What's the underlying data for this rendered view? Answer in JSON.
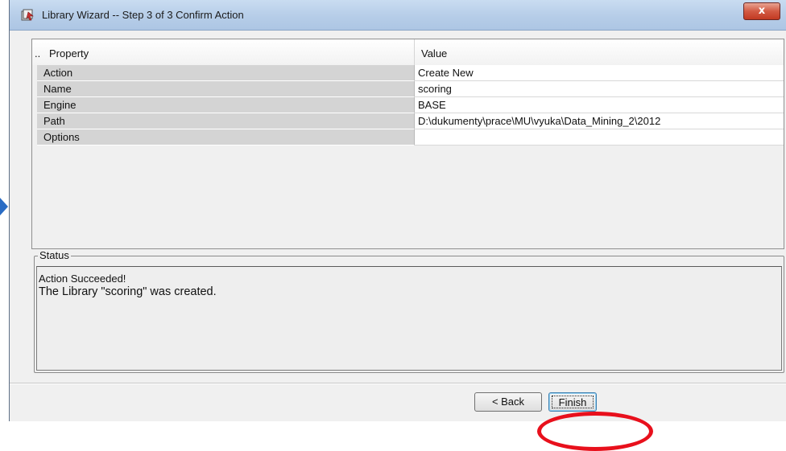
{
  "window": {
    "title": "Library Wizard  -- Step 3 of 3  Confirm Action",
    "close_label": "x"
  },
  "grid": {
    "header_dots": "..",
    "columns": [
      "Property",
      "Value"
    ],
    "rows": [
      {
        "property": "Action",
        "value": "Create New"
      },
      {
        "property": "Name",
        "value": "scoring"
      },
      {
        "property": "Engine",
        "value": "BASE"
      },
      {
        "property": "Path",
        "value": "D:\\dukumenty\\prace\\MU\\vyuka\\Data_Mining_2\\2012"
      },
      {
        "property": "Options",
        "value": ""
      }
    ]
  },
  "status": {
    "legend": "Status",
    "lines": [
      "Action Succeeded!",
      "The Library \"scoring\" was created."
    ]
  },
  "buttons": {
    "back": "< Back",
    "finish": "Finish"
  },
  "colors": {
    "highlight_ring": "#e8101c",
    "titlebar": "#b6cde8",
    "close_button": "#c23a22"
  }
}
